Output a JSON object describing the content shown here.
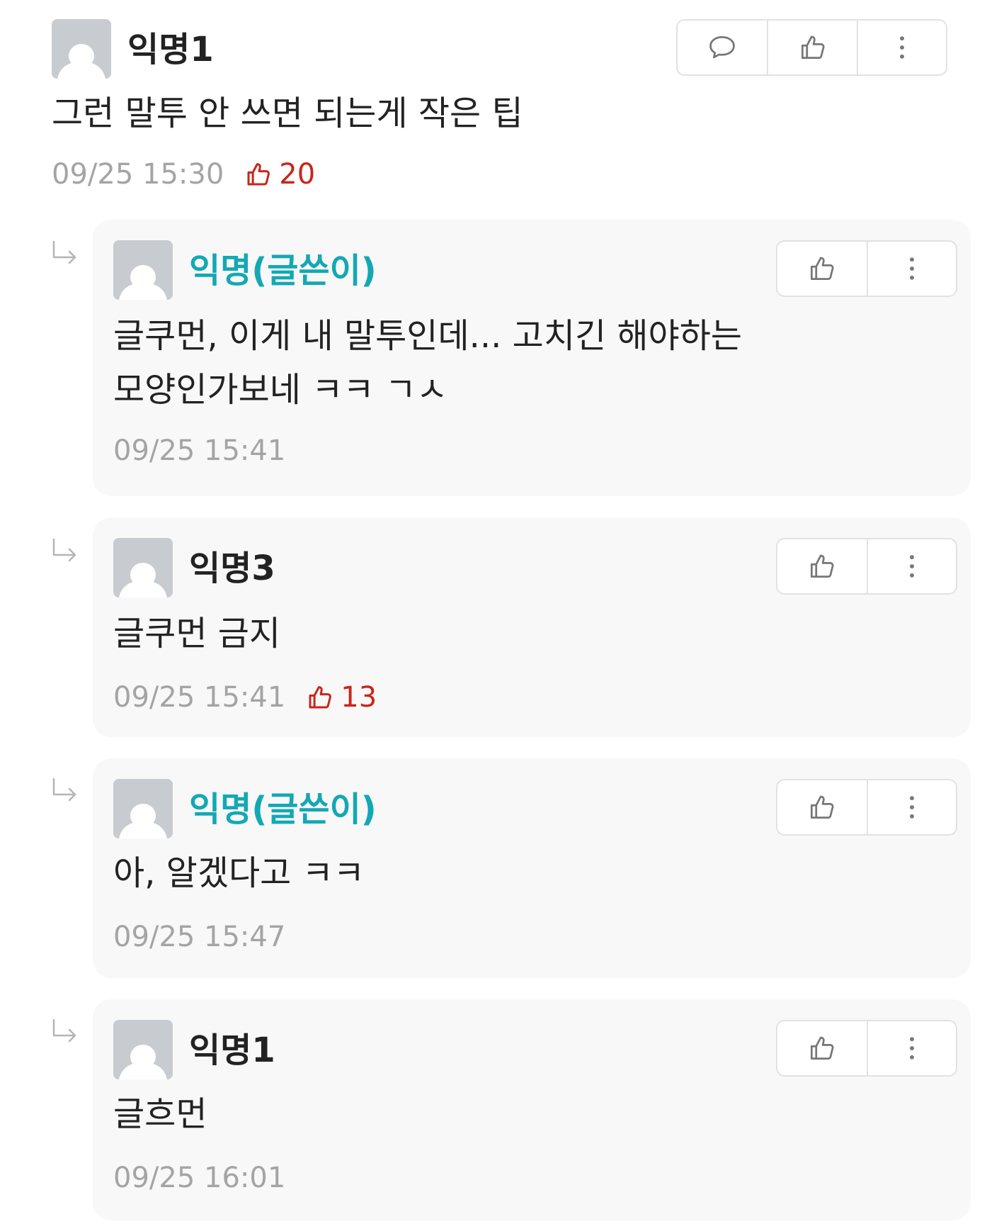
{
  "comments": [
    {
      "author": "익명1",
      "is_author": false,
      "text_lines": [
        "그런 말투 안 쓰면 되는게 작은 팁"
      ],
      "time": "09/25 15:30",
      "likes": "20",
      "buttons": [
        "comment-icon",
        "thumbs-up-icon",
        "more-vertical-icon"
      ]
    }
  ],
  "replies": [
    {
      "author": "익명(글쓴이)",
      "is_author": true,
      "text_lines": [
        "글쿠먼, 이게 내 말투인데... 고치긴 해야하는",
        "모양인가보네 ㅋㅋ ㄱㅅ"
      ],
      "time": "09/25 15:41",
      "likes": null,
      "buttons": [
        "thumbs-up-icon",
        "more-vertical-icon"
      ]
    },
    {
      "author": "익명3",
      "is_author": false,
      "text_lines": [
        "글쿠먼 금지"
      ],
      "time": "09/25 15:41",
      "likes": "13",
      "buttons": [
        "thumbs-up-icon",
        "more-vertical-icon"
      ]
    },
    {
      "author": "익명(글쓴이)",
      "is_author": true,
      "text_lines": [
        "아, 알겠다고 ㅋㅋ"
      ],
      "time": "09/25 15:47",
      "likes": null,
      "buttons": [
        "thumbs-up-icon",
        "more-vertical-icon"
      ]
    },
    {
      "author": "익명1",
      "is_author": false,
      "text_lines": [
        "글흐먼"
      ],
      "time": "09/25 16:01",
      "likes": null,
      "buttons": [
        "thumbs-up-icon",
        "more-vertical-icon"
      ]
    }
  ],
  "colors": {
    "author_name": "#13a8b4",
    "like_count": "#c9251a",
    "timestamp": "#a4a4a4",
    "reply_background": "#f8f8f8",
    "avatar": "#c8ccd0"
  }
}
